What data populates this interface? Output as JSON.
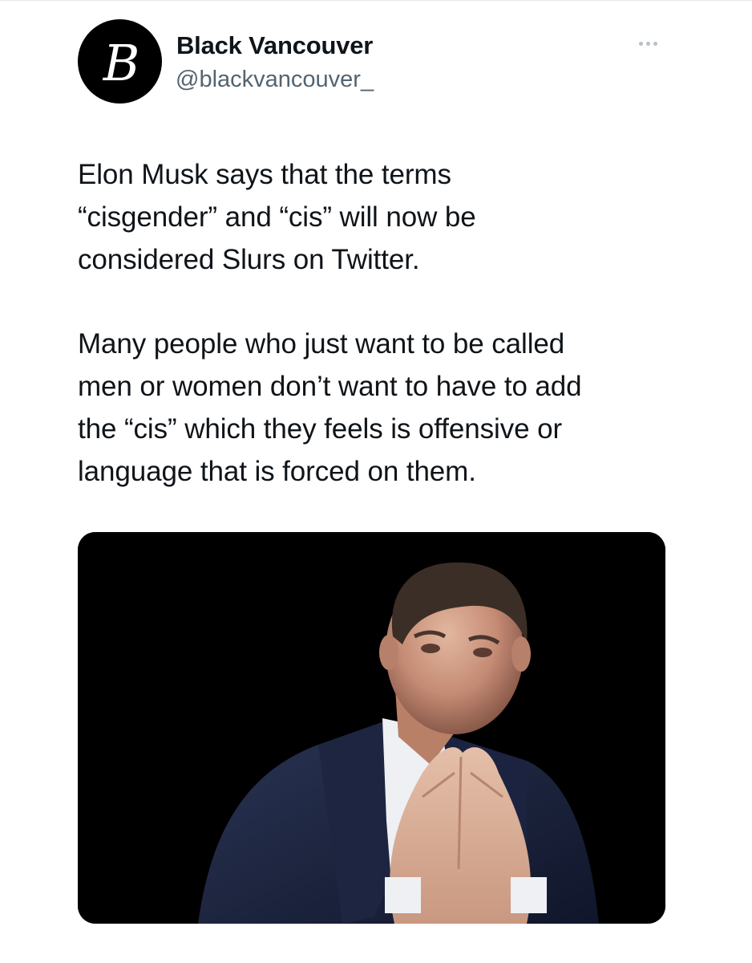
{
  "tweet": {
    "author": {
      "display_name": "Black Vancouver",
      "handle": "@blackvancouver_",
      "avatar_letter": "B",
      "avatar_bg": "#000000"
    },
    "more_icon": "more-horizontal-icon",
    "paragraphs": [
      "Elon Musk says that the terms\n“cisgender” and “cis” will now be\nconsidered Slurs on Twitter.",
      "Many people who just want to be called\nmen or women don’t want to have to add\nthe “cis” which they feels is offensive or\nlanguage that is forced on them."
    ],
    "media": {
      "kind": "photo",
      "background": "#000000"
    }
  },
  "colors": {
    "text_primary": "#0f1419",
    "text_secondary": "#536471",
    "icon_muted": "#b9c0c6"
  }
}
